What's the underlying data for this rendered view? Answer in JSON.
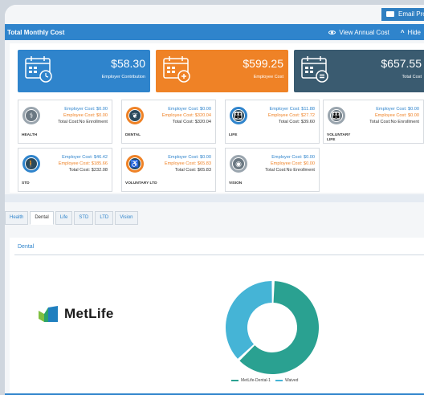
{
  "header": {
    "email_label": "Email Prospec"
  },
  "bar": {
    "title": "Total Monthly Cost",
    "view_annual": "View Annual Cost",
    "hide": "Hide"
  },
  "summary": [
    {
      "amount": "$58.30",
      "label": "Employer Contribution",
      "color": "#2f84cc"
    },
    {
      "amount": "$599.25",
      "label": "Employee Cost",
      "color": "#ef8226"
    },
    {
      "amount": "$657.55",
      "label": "Total Cost",
      "color": "#3a5b70"
    }
  ],
  "coverages": [
    {
      "name": "HEALTH",
      "icon": "caduceus-icon",
      "glyph": "⚕",
      "employer": "Employer Cost: $0.00",
      "employee": "Employee Cost: $0.00",
      "total": "Total Cost:No Enrollment",
      "ring": "#9aa5ae",
      "core": "#6b7882"
    },
    {
      "name": "DENTAL",
      "icon": "tooth-icon",
      "glyph": "❦",
      "employer": "Employer Cost: $0.00",
      "employee": "Employee Cost: $320.04",
      "total": "Total Cost: $320.04",
      "ring": "#ef8226",
      "core": "#2b4a5c"
    },
    {
      "name": "LIFE",
      "icon": "family-icon",
      "glyph": "👪",
      "employer": "Employer Cost: $11.88",
      "employee": "Employee Cost: $27.72",
      "total": "Total Cost: $39.60",
      "ring": "#2f84cc",
      "core": "#2b4a5c"
    },
    {
      "name": "VOLUNTARY LIFE",
      "icon": "family-icon",
      "glyph": "👪",
      "employer": "Employer Cost: $0.00",
      "employee": "Employee Cost: $0.00",
      "total": "Total Cost:No Enrollment",
      "ring": "#9aa5ae",
      "core": "#6b7882"
    },
    {
      "name": "STD",
      "icon": "elderly-person-icon",
      "glyph": "🚶",
      "employer": "Employer Cost: $46.42",
      "employee": "Employee Cost: $185.66",
      "total": "Total Cost: $232.08",
      "ring": "#2f84cc",
      "core": "#2b4a5c"
    },
    {
      "name": "VOLUNTARY LTD",
      "icon": "wheelchair-icon",
      "glyph": "♿",
      "employer": "Employer Cost: $0.00",
      "employee": "Employee Cost: $65.83",
      "total": "Total Cost: $65.83",
      "ring": "#ef8226",
      "core": "#2b4a5c"
    },
    {
      "name": "VISION",
      "icon": "eye-icon",
      "glyph": "◉",
      "employer": "Employer Cost: $0.00",
      "employee": "Employee Cost: $0.00",
      "total": "Total Cost:No Enrollment",
      "ring": "#9aa5ae",
      "core": "#6b7882"
    }
  ],
  "tabs": [
    {
      "label": "Health",
      "active": false
    },
    {
      "label": "Dental",
      "active": true
    },
    {
      "label": "Life",
      "active": false
    },
    {
      "label": "STD",
      "active": false
    },
    {
      "label": "LTD",
      "active": false
    },
    {
      "label": "Vision",
      "active": false
    }
  ],
  "dental": {
    "title": "Dental",
    "logo_text": "MetLife",
    "chart": {
      "type": "donut",
      "slices": [
        {
          "name": "MetLife-Dental-1",
          "fraction": 0.625,
          "color": "#2aa191",
          "label": ""
        },
        {
          "name": "Waived",
          "fraction": 0.375,
          "color": "#45b4d6",
          "label": ""
        }
      ]
    }
  }
}
